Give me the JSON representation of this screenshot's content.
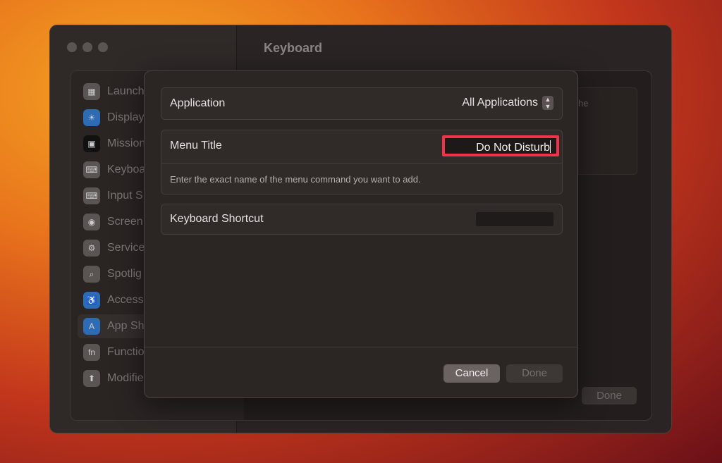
{
  "window": {
    "title": "Keyboard"
  },
  "sidebar": {
    "items": [
      {
        "label": "Launch",
        "icon": "launchpad-icon"
      },
      {
        "label": "Display",
        "icon": "display-icon"
      },
      {
        "label": "Mission",
        "icon": "mission-control-icon"
      },
      {
        "label": "Keyboa",
        "icon": "keyboard-icon"
      },
      {
        "label": "Input S",
        "icon": "input-sources-icon"
      },
      {
        "label": "Screen",
        "icon": "screenshot-icon"
      },
      {
        "label": "Service",
        "icon": "services-icon"
      },
      {
        "label": "Spotlig",
        "icon": "spotlight-icon"
      },
      {
        "label": "Access",
        "icon": "accessibility-icon"
      },
      {
        "label": "App Sh",
        "icon": "app-shortcuts-icon",
        "selected": true
      },
      {
        "label": "Functio",
        "icon": "function-keys-icon"
      },
      {
        "label": "Modifie",
        "icon": "modifier-keys-icon"
      }
    ]
  },
  "behind": {
    "partial_text": "he",
    "done_label": "Done"
  },
  "dialog": {
    "application_label": "Application",
    "application_value": "All Applications",
    "menu_title_label": "Menu Title",
    "menu_title_value": "Do Not Disturb",
    "menu_title_hint": "Enter the exact name of the menu command you want to add.",
    "shortcut_label": "Keyboard Shortcut",
    "cancel_label": "Cancel",
    "done_label": "Done",
    "highlight_color": "#f0334a"
  }
}
